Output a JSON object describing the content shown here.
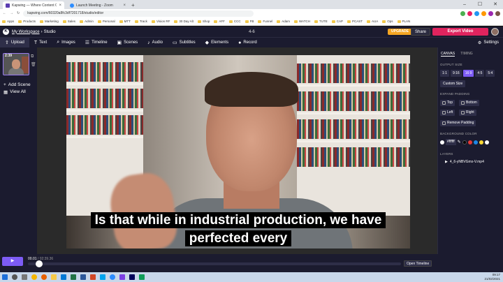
{
  "browser": {
    "tabs": [
      {
        "label": "Kapwing — Where Content Cre...",
        "active": true
      },
      {
        "label": "Launch Meeting - Zoom",
        "active": false
      }
    ],
    "new_tab": "+",
    "url": "kapwing.com/60320a8fc3df7201718/studio/editor",
    "window_controls": {
      "minimize": "–",
      "maximize": "☐",
      "close": "✕"
    },
    "bookmarks": [
      "Apps",
      "Products",
      "Marketing",
      "Sales",
      "Admin",
      "Personal",
      "MTT",
      "Track",
      "Vision RF",
      "30 Day Alt",
      "Shop",
      "AFF",
      "CCC",
      "FB",
      "Funnel",
      "Adam",
      "WATCH",
      "TUTE",
      "CAP",
      "PCAST",
      "AUA",
      "Ops",
      "PLAN"
    ]
  },
  "header": {
    "logo": "K",
    "workspace": "My Workspace",
    "separator": "›",
    "studio": "Studio",
    "project_name": "4-6",
    "upgrade": "UPGRADE",
    "share": "Share",
    "export": "Export Video"
  },
  "toolbar": {
    "upload": "Upload",
    "text": "Text",
    "images": "Images",
    "timeline": "Timeline",
    "scenes": "Scenes",
    "audio": "Audio",
    "subtitles": "Subtitles",
    "elements": "Elements",
    "record": "Record",
    "settings": "Settings"
  },
  "scenes": {
    "thumb_time": "2:39",
    "add_scene": "Add Scene",
    "view_all": "View All"
  },
  "video": {
    "subtitle_line1": "Is that while in industrial production, we have",
    "subtitle_line2": "perfected every"
  },
  "panel": {
    "tab_canvas": "CANVAS",
    "tab_timing": "TIMING",
    "output_size_label": "OUTPUT SIZE",
    "ratios": [
      {
        "label": "1:1",
        "selected": false
      },
      {
        "label": "9:16",
        "selected": false
      },
      {
        "label": "16:9",
        "selected": true
      },
      {
        "label": "4:5",
        "selected": false
      },
      {
        "label": "5:4",
        "selected": false
      }
    ],
    "custom_size": "Custom Size",
    "expand_padding_label": "EXPAND PADDING",
    "padding": {
      "top": "Top",
      "bottom": "Bottom",
      "left": "Left",
      "right": "Right",
      "remove": "Remove Padding"
    },
    "background_color_label": "BACKGROUND COLOR",
    "bg_hex": "#ffffff",
    "swatches": [
      "#ffffff",
      "#000000",
      "#e53935",
      "#1e88e5",
      "#fdd835",
      "#ffffff"
    ],
    "layers_label": "LAYERS",
    "layer_name": "4_6-yNBVGmx-V.mp4"
  },
  "timeline": {
    "current": "00.01",
    "slash": "/",
    "duration": "02:39.36",
    "progress": 0.03,
    "open_timeline": "Open Timeline"
  },
  "taskbar": {
    "time": "09:17",
    "date": "21/02/2021"
  }
}
